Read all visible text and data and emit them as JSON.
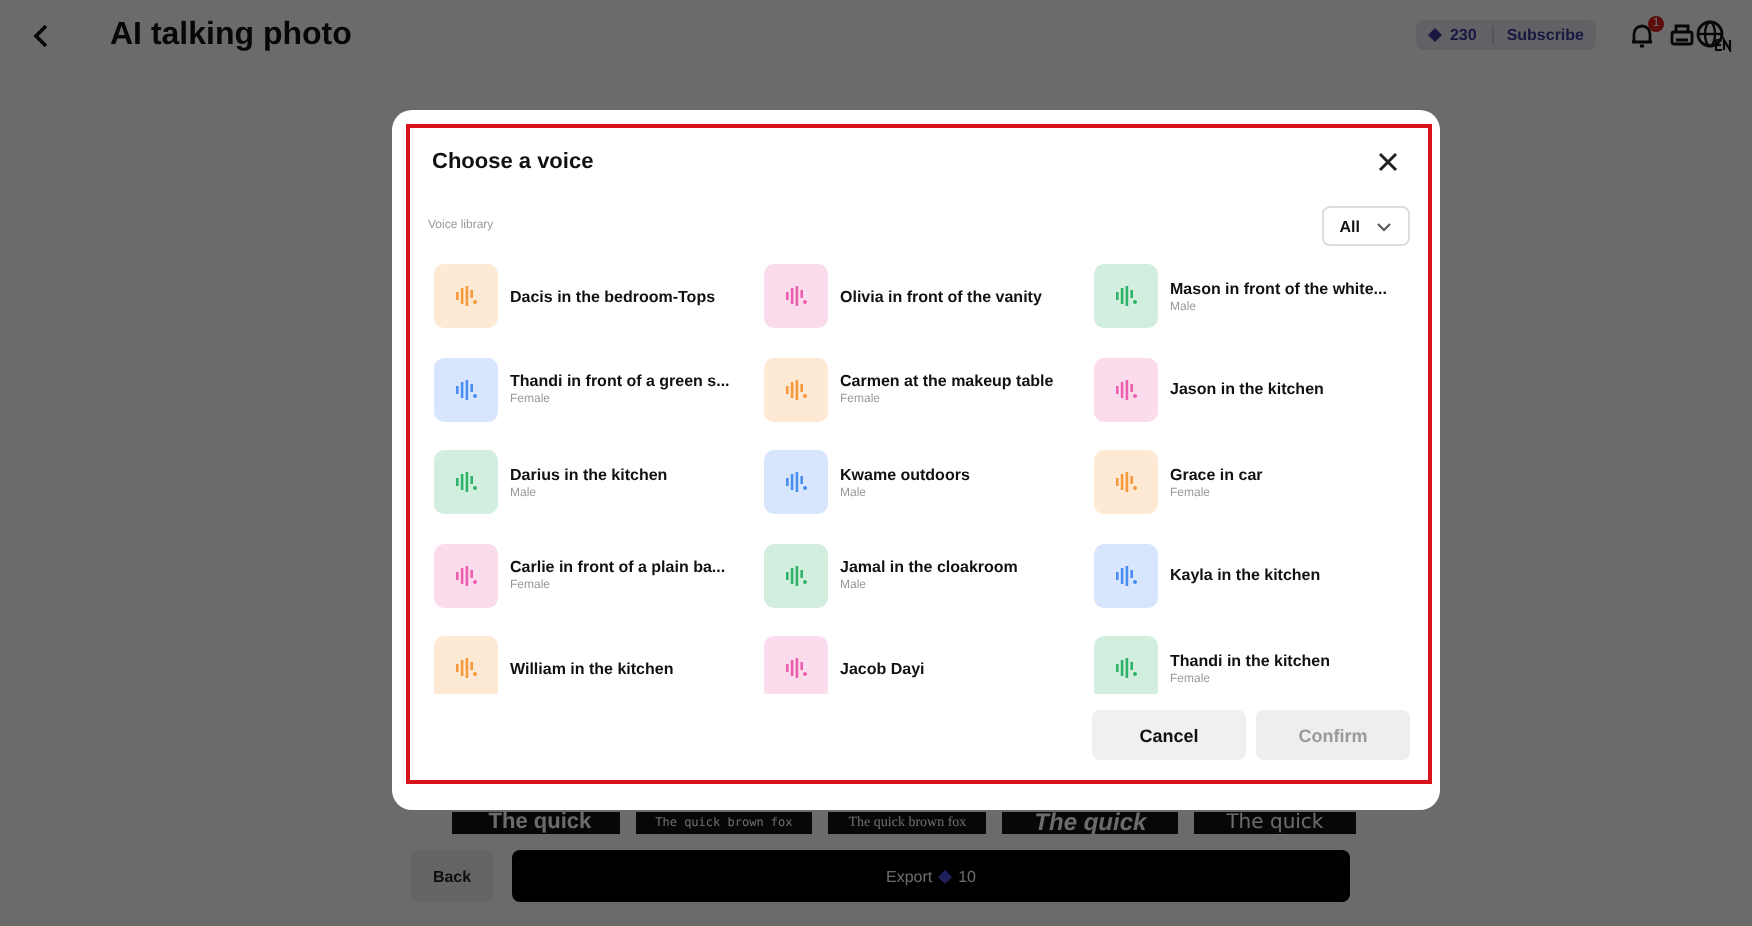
{
  "header": {
    "title": "AI talking photo",
    "credits": "230",
    "subscribe": "Subscribe",
    "notification_badge": "1"
  },
  "font_samples": [
    "The quick",
    "The quick brown fox",
    "The quick brown fox",
    "The quick",
    "The quick"
  ],
  "bottom_bar": {
    "back": "Back",
    "export": "Export",
    "export_cost": "10"
  },
  "dialog": {
    "title": "Choose a voice",
    "library_label": "Voice library",
    "filter": "All",
    "voices": [
      {
        "name": "Dacis in the bedroom-Tops",
        "color": "#f59a3c"
      },
      {
        "name": "Olivia in front of the vanity",
        "color": "#ec5fae"
      },
      {
        "name": "Mason in front of the white...",
        "gender": "Male",
        "color": "#2fb36a"
      },
      {
        "name": "Thandi in front of a green s...",
        "gender": "Female",
        "color": "#4b8ef0"
      },
      {
        "name": "Carmen at the makeup table",
        "gender": "Female",
        "color": "#f59a3c"
      },
      {
        "name": "Jason in the kitchen",
        "color": "#ec5fae"
      },
      {
        "name": "Darius in the kitchen",
        "gender": "Male",
        "color": "#2fb36a"
      },
      {
        "name": "Kwame outdoors",
        "gender": "Male",
        "color": "#4b8ef0"
      },
      {
        "name": "Grace in car",
        "gender": "Female",
        "color": "#f59a3c"
      },
      {
        "name": "Carlie in front of a plain ba...",
        "gender": "Female",
        "color": "#ec5fae"
      },
      {
        "name": "Jamal in the cloakroom",
        "gender": "Male",
        "color": "#2fb36a"
      },
      {
        "name": "Kayla in the kitchen",
        "color": "#4b8ef0"
      },
      {
        "name": "William in the kitchen",
        "color": "#f59a3c"
      },
      {
        "name": "Jacob Dayi",
        "color": "#ec5fae"
      },
      {
        "name": "Thandi in the kitchen",
        "gender": "Female",
        "color": "#2fb36a"
      }
    ],
    "cancel": "Cancel",
    "confirm": {
      "label": "Confirm",
      "disabled": true
    }
  }
}
